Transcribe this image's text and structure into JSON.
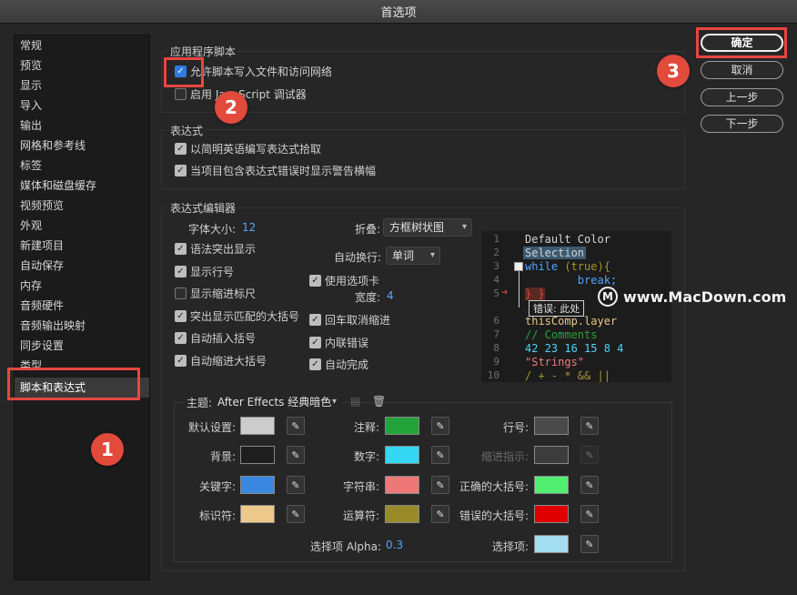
{
  "window": {
    "title": "首选项"
  },
  "sidebar": {
    "items": [
      {
        "label": "常规"
      },
      {
        "label": "预览"
      },
      {
        "label": "显示"
      },
      {
        "label": "导入"
      },
      {
        "label": "输出"
      },
      {
        "label": "网格和参考线"
      },
      {
        "label": "标签"
      },
      {
        "label": "媒体和磁盘缓存"
      },
      {
        "label": "视频预览"
      },
      {
        "label": "外观"
      },
      {
        "label": "新建项目"
      },
      {
        "label": "自动保存"
      },
      {
        "label": "内存"
      },
      {
        "label": "音频硬件"
      },
      {
        "label": "音频输出映射"
      },
      {
        "label": "同步设置"
      },
      {
        "label": "类型"
      },
      {
        "label": "脚本和表达式"
      }
    ],
    "selected": "脚本和表达式"
  },
  "scripting": {
    "title": "应用程序脚本",
    "allow_write": {
      "label": "允许脚本写入文件和访问网络",
      "checked": true
    },
    "debugger": {
      "label": "启用 JavaScript 调试器",
      "checked": false
    }
  },
  "expressions": {
    "title": "表达式",
    "pick_whip": {
      "label": "以简明英语编写表达式拾取",
      "checked": true
    },
    "warning_banner": {
      "label": "当项目包含表达式错误时显示警告横幅",
      "checked": true
    }
  },
  "editor": {
    "title": "表达式编辑器",
    "font_size_label": "字体大小:",
    "font_size": "12",
    "fold_label": "折叠:",
    "fold_value": "方框树状图",
    "wrap_label": "自动换行:",
    "wrap_value": "单词",
    "tab_width_label": "宽度:",
    "tab_width": "4",
    "left_checks": [
      {
        "label": "语法突出显示",
        "checked": true
      },
      {
        "label": "显示行号",
        "checked": true
      },
      {
        "label": "显示缩进标尺",
        "checked": false
      },
      {
        "label": "突出显示匹配的大括号",
        "checked": true
      },
      {
        "label": "自动插入括号",
        "checked": true
      },
      {
        "label": "自动缩进大括号",
        "checked": true
      }
    ],
    "mid_checks": [
      {
        "label": "使用选项卡",
        "checked": true
      },
      {
        "label": "回车取消缩进",
        "checked": true
      },
      {
        "label": "内联错误",
        "checked": true
      },
      {
        "label": "自动完成",
        "checked": true
      }
    ],
    "code_preview": {
      "line_numbers": [
        "1",
        "2",
        "3",
        "4",
        "5",
        "",
        "6",
        "7",
        "8",
        "9",
        "10"
      ],
      "lines": [
        {
          "text": "Default Color",
          "color": "#d4d4d4"
        },
        {
          "text": "Selection",
          "color": "#d4d4d4"
        },
        {
          "text": "while",
          "extra": " (true){",
          "color": "#4fa3ff"
        },
        {
          "text": "        break;",
          "color": "#4fa3ff"
        },
        {
          "text": "} }",
          "color": "#e0443a"
        },
        {
          "text": "错误: 此处",
          "color": "#e0e0e0"
        },
        {
          "text": "thisComp.layer",
          "color": "#e8c88a"
        },
        {
          "text": "// Comments",
          "color": "#27a33a"
        },
        {
          "text": "42 23 16 15 8 4",
          "color": "#4fd3f5"
        },
        {
          "text": "\"Strings\"",
          "color": "#f07a7a"
        },
        {
          "text": "/ + - * && ||",
          "color": "#a8952f"
        }
      ]
    }
  },
  "theme": {
    "label": "主题:",
    "value": "After Effects 经典暗色",
    "colors": [
      {
        "label": "默认设置:",
        "color": "#cccccc"
      },
      {
        "label": "注释:",
        "color": "#23a33a"
      },
      {
        "label": "行号:",
        "color": "#4a4a4a"
      },
      {
        "label": "背景:",
        "color": "#1e1e1e"
      },
      {
        "label": "数字:",
        "color": "#36d6f5"
      },
      {
        "label": "缩进指示:",
        "color": "#3c3c3c"
      },
      {
        "label": "关键字:",
        "color": "#3a88e0"
      },
      {
        "label": "字符串:",
        "color": "#ee7878"
      },
      {
        "label": "正确的大括号:",
        "color": "#52ee72"
      },
      {
        "label": "标识符:",
        "color": "#ecc98a"
      },
      {
        "label": "运算符:",
        "color": "#9a8b2a"
      },
      {
        "label": "错误的大括号:",
        "color": "#e00000"
      }
    ],
    "alpha_label": "选择项 Alpha:",
    "alpha_value": "0.3",
    "selection_label": "选择项:",
    "selection_color": "#a4ddf0"
  },
  "buttons": {
    "ok": "确定",
    "cancel": "取消",
    "prev": "上一步",
    "next": "下一步"
  },
  "annotations": {
    "badge1": "1",
    "badge2": "2",
    "badge3": "3",
    "accent": "#e8463f"
  },
  "watermark": {
    "icon": "M",
    "text": "www.MacDown.com"
  }
}
